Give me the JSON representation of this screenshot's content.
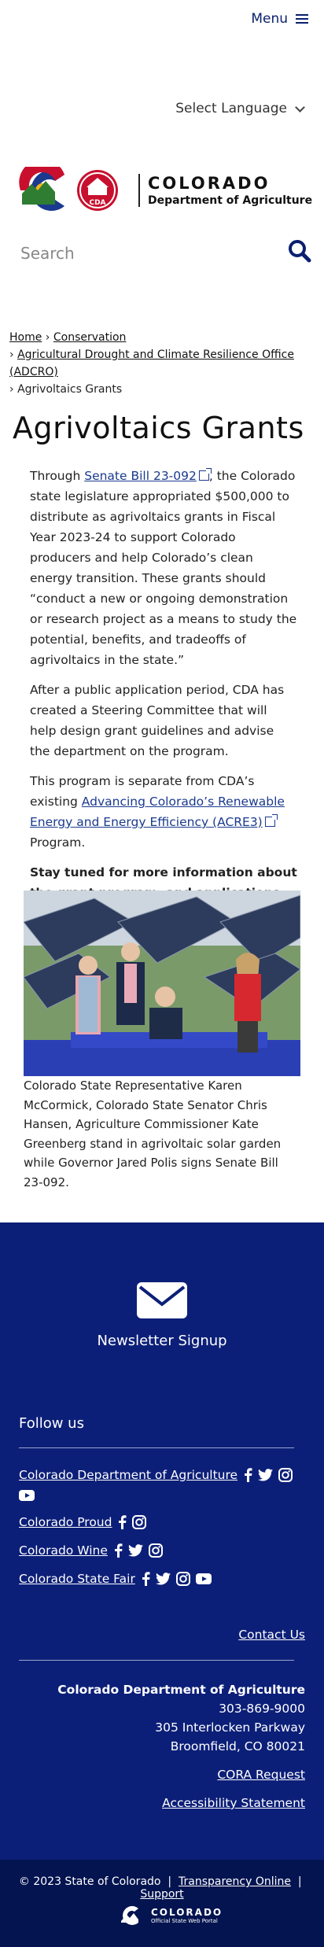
{
  "header": {
    "menu_label": "Menu",
    "language_label": "Select Language",
    "logo_line1": "COLORADO",
    "logo_line2": "Department of Agriculture",
    "logo_badge": "CDA",
    "search_placeholder": "Search"
  },
  "breadcrumb": {
    "home": "Home",
    "sep": "›",
    "conservation": "Conservation",
    "adcro": "Agricultural Drought and Climate Resilience Office (ADCRO)",
    "current": "Agrivoltaics Grants"
  },
  "main": {
    "title": "Agrivoltaics Grants",
    "p1_pre": "Through ",
    "p1_link": "Senate Bill 23-092",
    "p1_post": ", the Colorado state legislature appropriated $500,000 to distribute as agrivoltaics grants in Fiscal Year 2023-24 to support Colorado producers and help Colorado’s clean energy transition. These grants should “conduct a new or ongoing demonstration or research project as a means to study the potential, benefits, and tradeoffs of agrivoltaics in the state.”",
    "p2": "After a public application period, CDA has created a Steering Committee that will help design grant guidelines and advise the department on the program.",
    "p3_pre": "This program is separate from CDA’s existing ",
    "p3_link": "Advancing Colorado’s Renewable Energy and Energy Efficiency (ACRE3)",
    "p3_post": " Program.",
    "p4": "Stay tuned for more information about the grant program, and applications to apply.",
    "caption": "Colorado State Representative Karen McCormick, Colorado State Senator Chris Hansen, Agriculture Commissioner Kate Greenberg stand in agrivoltaic solar garden while Governor Jared Polis signs Senate Bill 23-092."
  },
  "footer": {
    "newsletter": "Newsletter Signup",
    "follow": "Follow us",
    "social": [
      {
        "label": "Colorado Department of Agriculture",
        "icons": [
          "facebook-icon",
          "twitter-icon",
          "instagram-icon",
          "youtube-icon"
        ]
      },
      {
        "label": "Colorado Proud",
        "icons": [
          "facebook-icon",
          "instagram-icon"
        ]
      },
      {
        "label": "Colorado Wine",
        "icons": [
          "facebook-icon",
          "twitter-icon",
          "instagram-icon"
        ]
      },
      {
        "label": "Colorado State Fair",
        "icons": [
          "facebook-icon",
          "twitter-icon",
          "instagram-icon",
          "youtube-icon"
        ]
      }
    ],
    "contact": "Contact Us",
    "org": "Colorado Department of Agriculture",
    "phone": "303-869-9000",
    "address1": "305 Interlocken Parkway",
    "address2": "Broomfield, CO 80021",
    "cora": "CORA Request",
    "accessibility": "Accessibility Statement"
  },
  "bottom": {
    "copyright": "© 2023 State of Colorado",
    "sep": "|",
    "transparency": "Transparency Online",
    "support": "Support",
    "portal_line1": "COLORADO",
    "portal_line2": "Official State Web Portal"
  },
  "colors": {
    "footer_bg": "#0c1f78",
    "bottom_bg": "#041450",
    "link": "#1a3a8f",
    "menu": "#0a1f6e"
  }
}
